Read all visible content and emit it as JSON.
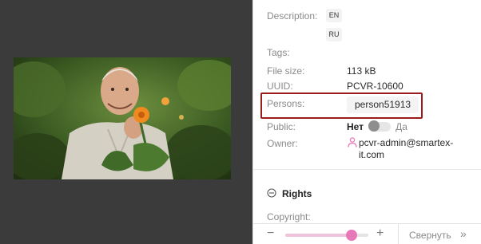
{
  "description_label": "Description:",
  "languages": [
    "EN",
    "RU"
  ],
  "tags_label": "Tags:",
  "file_size": {
    "label": "File size:",
    "value": "113 kB"
  },
  "uuid": {
    "label": "UUID:",
    "value": "PCVR-10600"
  },
  "persons": {
    "label": "Persons:",
    "items": [
      "person51913"
    ]
  },
  "public": {
    "label": "Public:",
    "off_text": "Нет",
    "on_text": "Да",
    "enabled": false
  },
  "owner": {
    "label": "Owner:",
    "value": "pcvr-admin@smartex-it.com"
  },
  "rights": {
    "title": "Rights"
  },
  "copyright_label": "Copyright:",
  "toolbar": {
    "collapse_label": "Свернуть",
    "zoom_level": 0.8
  },
  "colors": {
    "highlight_border": "#9b1c1c",
    "accent": "#e879b8"
  }
}
